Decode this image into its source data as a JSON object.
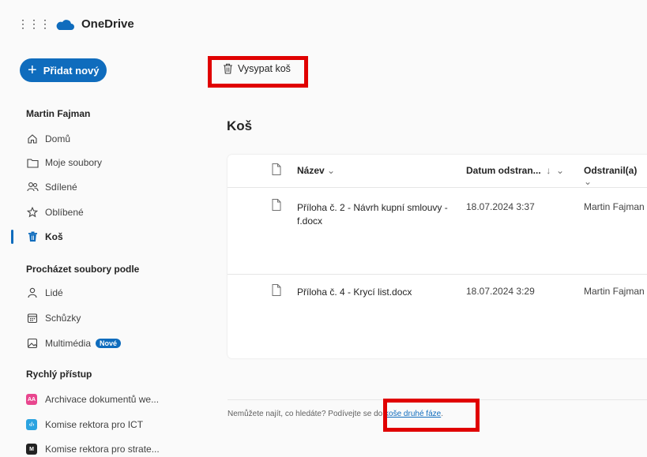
{
  "app": {
    "name": "OneDrive",
    "accent": "#0f6cbd"
  },
  "sidebar": {
    "add_new_label": "Přidat nový",
    "user_name": "Martin Fajman",
    "nav": [
      {
        "label": "Domů",
        "icon": "home-icon"
      },
      {
        "label": "Moje soubory",
        "icon": "folder-icon"
      },
      {
        "label": "Sdílené",
        "icon": "people-icon"
      },
      {
        "label": "Oblíbené",
        "icon": "star-icon"
      },
      {
        "label": "Koš",
        "icon": "trash-icon",
        "active": true
      }
    ],
    "browse_heading": "Procházet soubory podle",
    "browse": [
      {
        "label": "Lidé",
        "icon": "person-icon"
      },
      {
        "label": "Schůzky",
        "icon": "calendar-icon"
      },
      {
        "label": "Multimédia",
        "icon": "image-icon",
        "badge": "Nové"
      }
    ],
    "quick_access_heading": "Rychlý přístup",
    "quick_access": [
      {
        "label": "Archivace dokumentů we...",
        "tile_text": "AA",
        "color": "#e8468e"
      },
      {
        "label": "Komise rektora pro ICT",
        "tile_text": "‹/›",
        "color": "#2ba3e0"
      },
      {
        "label": "Komise rektora pro strate...",
        "tile_text": "M",
        "color": "#222222"
      }
    ]
  },
  "command_bar": {
    "empty_bin_label": "Vysypat koš"
  },
  "main": {
    "title": "Koš",
    "columns": {
      "name": "Název",
      "date_deleted": "Datum odstran...",
      "deleted_by": "Odstranil(a)"
    },
    "rows": [
      {
        "name": "Příloha č. 2 - Návrh kupní smlouvy - f.docx",
        "date": "18.07.2024 3:37",
        "deleted_by": "Martin Fajman"
      },
      {
        "name": "Příloha č. 4 - Krycí list.docx",
        "date": "18.07.2024 3:29",
        "deleted_by": "Martin Fajman"
      }
    ]
  },
  "footer": {
    "text_before": "Nemůžete najít, co hledáte? Podívejte se do",
    "link_text": "koše druhé fáze",
    "text_after": "."
  }
}
